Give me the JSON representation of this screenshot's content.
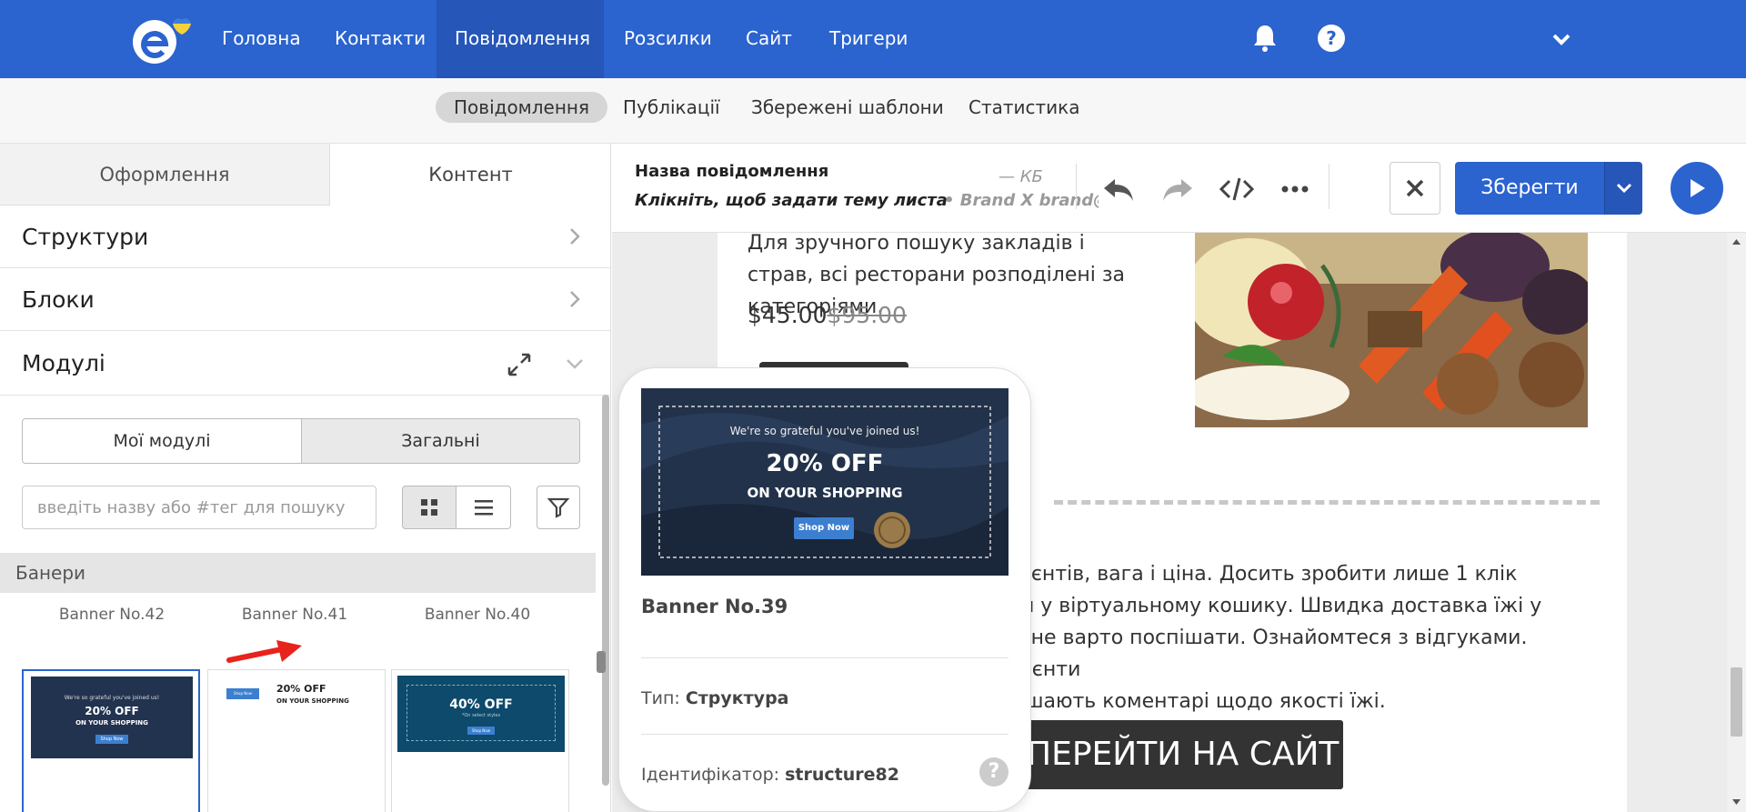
{
  "top_nav": {
    "items": [
      "Головна",
      "Контакти",
      "Повідомлення",
      "Розсилки",
      "Сайт",
      "Тригери"
    ],
    "active": "Повідомлення",
    "icons": [
      "bell-icon",
      "help-icon",
      "chevron-down-icon"
    ],
    "brand_color": "#2b63cf"
  },
  "sub_nav": {
    "items": [
      "Повідомлення",
      "Публікації",
      "Збережені шаблони",
      "Статистика"
    ],
    "active": "Повідомлення"
  },
  "left_panel": {
    "tabs": [
      "Оформлення",
      "Контент"
    ],
    "active_tab": "Контент",
    "sections": [
      "Структури",
      "Блоки",
      "Модулі"
    ],
    "module_toggle": [
      "Мої модулі",
      "Загальні"
    ],
    "module_toggle_active": "Загальні",
    "search_placeholder": "введіть назву або #тег для пошуку",
    "category": "Банери",
    "banners": [
      {
        "name": "Banner No.42",
        "thumb_line1": "We're so grateful you've joined us!",
        "thumb_line2": "20% OFF",
        "thumb_line3": "ON YOUR SHOPPING",
        "thumb_btn": "Shop Now"
      },
      {
        "name": "Banner No.41",
        "thumb_line1": "20% OFF",
        "thumb_line2": "ON YOUR SHOPPING",
        "thumb_btn": "Shop Now"
      },
      {
        "name": "Banner No.40",
        "thumb_line1": "40% OFF",
        "thumb_line2": "*On select styles",
        "thumb_btn": "Shop Now"
      }
    ]
  },
  "editor_header": {
    "message_name": "Назва повідомлення",
    "subject_hint": "Клікніть, щоб задати тему листа",
    "sender_initials": "— КБ",
    "sender_name": "• Brand X brand@",
    "save_label": "Зберегти"
  },
  "email_preview": {
    "product_text": "Для зручного пошуку закладів і страв, всі ресторани розподілені за категоріями.",
    "price_new": "$45.00",
    "price_old": "$95.00",
    "desc_lines": [
      "едієнтів, вага і ціна. Досить зробити лише 1 клік",
      "ься у віртуальному кошику. Швидка доставка їжі у",
      "ле не варто поспішати. Ознайомтеся з відгуками. Клієнти",
      "лишають коментарі щодо якості їжі."
    ],
    "cta_label": "ПЕРЕЙТИ НА САЙТ"
  },
  "popup": {
    "banner_line1": "We're so grateful you've joined us!",
    "banner_line2": "20% OFF",
    "banner_line3": "ON YOUR SHOPPING",
    "banner_btn": "Shop Now",
    "title": "Banner No.39",
    "type_label": "Тип:",
    "type_value": "Структура",
    "id_label": "Ідентифікатор:",
    "id_value": "structure82",
    "help_glyph": "?"
  }
}
